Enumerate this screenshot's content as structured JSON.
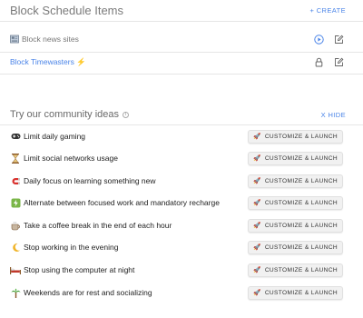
{
  "block_section": {
    "title": "Block Schedule Items",
    "create_label": "+ CREATE",
    "items": [
      {
        "label": "Block news sites",
        "icon": "newspaper-icon",
        "style": "muted"
      },
      {
        "label": "Block Timewasters ⚡",
        "icon": "",
        "style": "link"
      }
    ]
  },
  "community_section": {
    "title": "Try our community ideas",
    "hide_label": "X HIDE",
    "button_label": "CUSTOMIZE & LAUNCH",
    "ideas": [
      {
        "label": "Limit daily gaming",
        "icon": "gamepad-icon",
        "glyph": "🎮"
      },
      {
        "label": "Limit social networks usage",
        "icon": "hourglass-icon",
        "glyph": "⏳"
      },
      {
        "label": "Daily focus on learning something new",
        "icon": "magnet-icon",
        "glyph": ""
      },
      {
        "label": "Alternate between focused work and mandatory recharge",
        "icon": "recharge-icon",
        "glyph": ""
      },
      {
        "label": "Take a coffee break in the end of each hour",
        "icon": "coffee-icon",
        "glyph": "☕"
      },
      {
        "label": "Stop working in the evening",
        "icon": "moon-icon",
        "glyph": "🌙"
      },
      {
        "label": "Stop using the computer at night",
        "icon": "bed-icon",
        "glyph": "🛏"
      },
      {
        "label": "Weekends are for rest and socializing",
        "icon": "tree-icon",
        "glyph": "🌴"
      }
    ]
  },
  "colors": {
    "accent": "#4a84e8",
    "text": "#222222",
    "muted": "#777777",
    "divider": "#e6e6e6"
  }
}
